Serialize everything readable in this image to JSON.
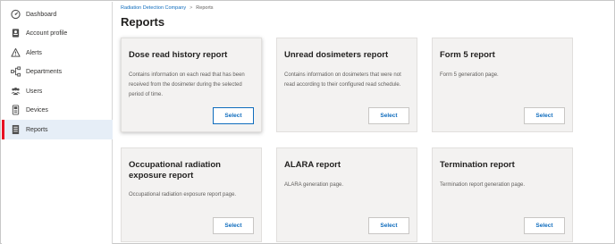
{
  "sidebar": {
    "items": [
      {
        "label": "Dashboard",
        "icon": "gauge-icon"
      },
      {
        "label": "Account profile",
        "icon": "id-card-icon"
      },
      {
        "label": "Alerts",
        "icon": "warning-icon"
      },
      {
        "label": "Departments",
        "icon": "org-chart-icon"
      },
      {
        "label": "Users",
        "icon": "users-icon"
      },
      {
        "label": "Devices",
        "icon": "dosimeter-icon"
      },
      {
        "label": "Reports",
        "icon": "report-icon"
      }
    ],
    "active_item": "Reports"
  },
  "breadcrumb": {
    "company": "Radiation Detection Company",
    "separator": ">",
    "current": "Reports"
  },
  "page": {
    "title": "Reports"
  },
  "cards": [
    {
      "title": "Dose read history report",
      "description": "Contains information on each read that has been received from the dosimeter during the selected period of time.",
      "button": "Select"
    },
    {
      "title": "Unread dosimeters report",
      "description": "Contains information on dosimeters that were not read according to their configured read schedule.",
      "button": "Select"
    },
    {
      "title": "Form 5 report",
      "description": "Form 5 generation page.",
      "button": "Select"
    },
    {
      "title": "Occupational radiation exposure report",
      "description": "Occupational radiation exposure report page.",
      "button": "Select"
    },
    {
      "title": "ALARA report",
      "description": "ALARA generation page.",
      "button": "Select"
    },
    {
      "title": "Termination report",
      "description": "Termination report generation page.",
      "button": "Select"
    }
  ],
  "colors": {
    "accent": "#0f6cbd",
    "active_marker": "#e81123",
    "active_bg": "#e6eef7",
    "card_bg": "#f3f2f1"
  }
}
